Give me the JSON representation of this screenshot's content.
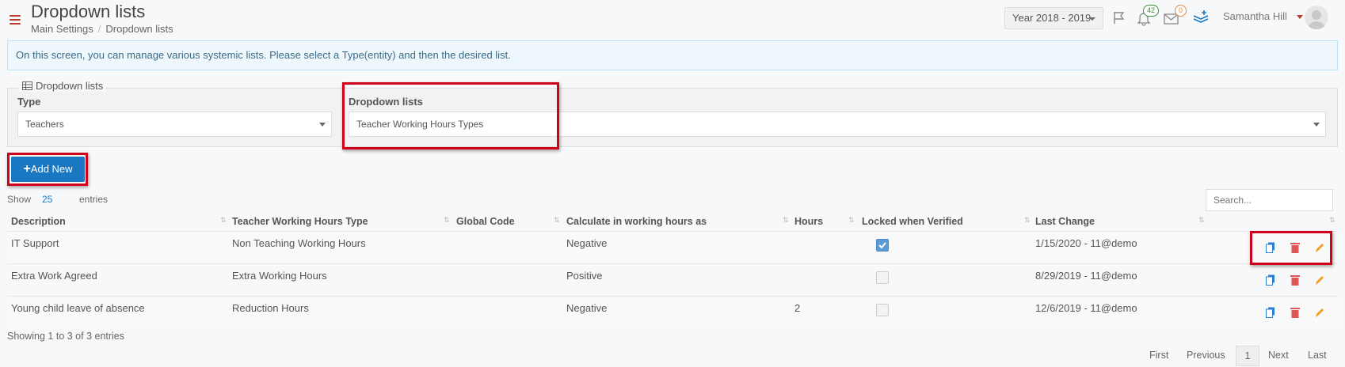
{
  "header": {
    "title": "Dropdown lists",
    "breadcrumb": [
      "Main Settings",
      "Dropdown lists"
    ],
    "year": "Year 2018 - 2019",
    "notifications_count": "42",
    "messages_count": "0",
    "user_name": "Samantha Hill"
  },
  "info": "On this screen, you can manage various systemic lists. Please select a Type(entity) and then the desired list.",
  "filters": {
    "legend": "Dropdown lists",
    "type_label": "Type",
    "type_value": "Teachers",
    "list_label": "Dropdown lists",
    "list_value": "Teacher Working Hours Types"
  },
  "add_new_label": "Add New",
  "length": {
    "show": "Show",
    "value": "25",
    "entries": "entries"
  },
  "search_placeholder": "Search...",
  "table": {
    "columns": [
      "Description",
      "Teacher Working Hours Type",
      "Global Code",
      "Calculate in working hours as",
      "Hours",
      "Locked when Verified",
      "Last Change"
    ],
    "rows": [
      {
        "description": "IT Support",
        "type": "Non Teaching Working Hours",
        "global_code": "",
        "calculate": "Negative",
        "hours": "",
        "locked": true,
        "last_change": "1/15/2020 - 11@demo"
      },
      {
        "description": "Extra Work Agreed",
        "type": "Extra Working Hours",
        "global_code": "",
        "calculate": "Positive",
        "hours": "",
        "locked": false,
        "last_change": "8/29/2019 - 11@demo"
      },
      {
        "description": "Young child leave of absence",
        "type": "Reduction Hours",
        "global_code": "",
        "calculate": "Negative",
        "hours": "2",
        "locked": false,
        "last_change": "12/6/2019 - 11@demo"
      }
    ]
  },
  "showing": "Showing 1 to 3 of 3 entries",
  "pagination": {
    "first": "First",
    "previous": "Previous",
    "current": "1",
    "next": "Next",
    "last": "Last"
  },
  "colors": {
    "accent": "#1a78c2",
    "danger": "#d0021b",
    "copy": "#2a7fd0",
    "delete": "#e05555",
    "edit": "#f0a020"
  }
}
